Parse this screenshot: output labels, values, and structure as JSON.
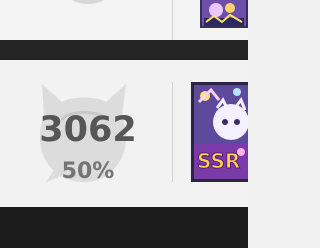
{
  "main_card": {
    "score": "3062",
    "percent": "50%"
  },
  "icons": {
    "watermark": "cat-ghost-icon",
    "top_watermark": "cat-ghost-icon",
    "thumbnail_top": "character-card-thumbnail",
    "thumbnail_main": "ssr-character-card-thumbnail"
  },
  "thumbnail_badge": "SSR",
  "colors": {
    "score": "#565656",
    "percent": "#747474",
    "dark_band": "#242424"
  }
}
